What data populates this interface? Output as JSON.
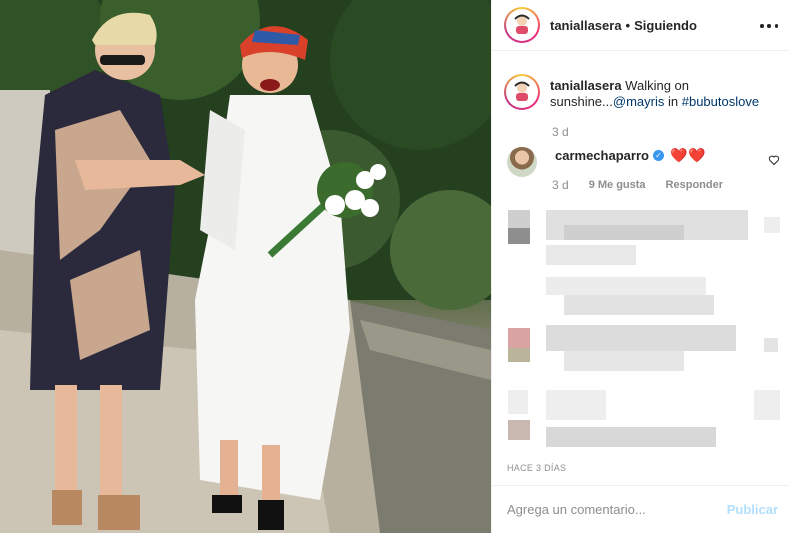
{
  "post": {
    "username": "taniallasera",
    "separator": "•",
    "follow_status": "Siguiendo",
    "more_icon": "more-horizontal-icon",
    "photo_alt_icon": "post-photo"
  },
  "caption": {
    "username": "taniallasera",
    "text": "Walking on sunshine...",
    "mention": "@mayris",
    "connector": "in",
    "hashtag": "#bubutoslove",
    "time": "3 d"
  },
  "comment": {
    "username": "carmechaparro",
    "verified": true,
    "text": "❤️❤️",
    "time": "3 d",
    "likes": "9 Me gusta",
    "reply": "Responder"
  },
  "posted_ago": "HACE 3 DÍAS",
  "add_comment": {
    "placeholder": "Agrega un comentario...",
    "publish": "Publicar"
  },
  "colors": {
    "link": "#00376b",
    "muted": "#8e8e8e",
    "publish_disabled": "#b2dffc",
    "verified": "#3897f0"
  }
}
